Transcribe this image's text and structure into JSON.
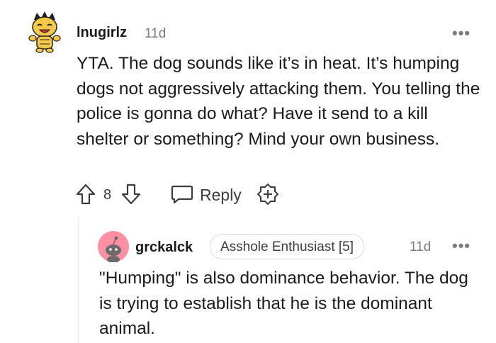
{
  "comment": {
    "username": "lnugirlz",
    "time": "11d",
    "more_icon": "more-horizontal-icon",
    "more_label": "•••",
    "body": "YTA. The dog sounds like it’s in heat. It’s humping dogs not aggressively attacking them. You telling the police is gonna do what? Have it send to a kill shelter or something? Mind your own business.",
    "vote_count": "8",
    "reply_label": "Reply"
  },
  "reply": {
    "username": "grckalck",
    "flair": "Asshole Enthusiast [5]",
    "time": "11d",
    "more_label": "•••",
    "body": "\"Humping\" is also dominance behavior. The dog is trying to establish that he is the dominant animal."
  },
  "colors": {
    "text": "#1a1a1b",
    "muted": "#7c7c7c",
    "avatar1_bg": "#f7c948",
    "avatar2_bg": "#ff8fa3",
    "thread_line": "#edeff1"
  }
}
